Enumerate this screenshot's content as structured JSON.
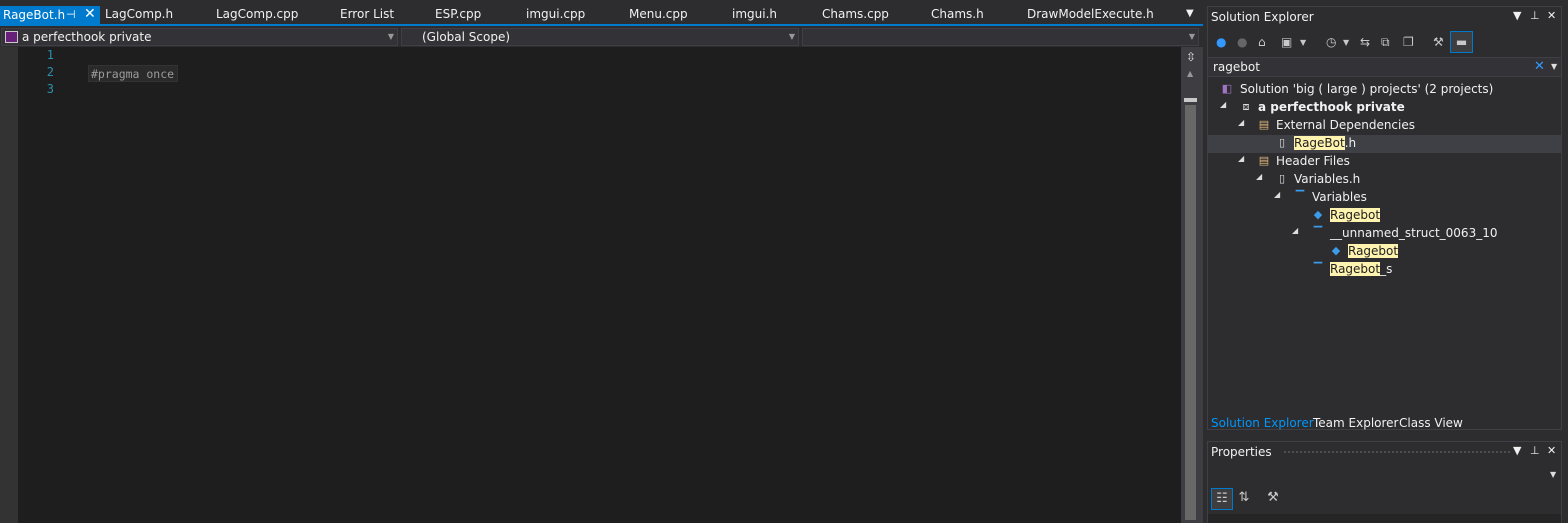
{
  "tabs": {
    "active": {
      "label": "RageBot.h",
      "pin": "⊣",
      "close": "✕"
    },
    "others": [
      "LagComp.h",
      "LagComp.cpp",
      "Error List",
      "ESP.cpp",
      "imgui.cpp",
      "Menu.cpp",
      "imgui.h",
      "Chams.cpp",
      "Chams.h",
      "DrawModelExecute.h"
    ]
  },
  "navbar": {
    "project": "a perfecthook private",
    "scope": "(Global Scope)",
    "member": ""
  },
  "editor": {
    "line_numbers": [
      "1",
      "2",
      "3"
    ],
    "code": "#pragma once"
  },
  "solution_explorer": {
    "title": "Solution Explorer",
    "search_value": "ragebot",
    "tree": [
      {
        "text": "Solution 'big ( large ) projects' (2 projects)",
        "icon": "solution-icon"
      },
      {
        "text": "a perfecthook private",
        "icon": "project-icon"
      },
      {
        "text": "External Dependencies",
        "icon": "folder-icon"
      },
      {
        "hl": "RageBot",
        "rest": ".h",
        "icon": "file-icon"
      },
      {
        "text": "Header Files",
        "icon": "folder-icon"
      },
      {
        "text": "Variables.h",
        "icon": "file-icon"
      },
      {
        "text": "Variables",
        "icon": "struct-icon"
      },
      {
        "hl": "Ragebot",
        "rest": "",
        "icon": "field-icon"
      },
      {
        "text": "__unnamed_struct_0063_10",
        "icon": "struct-icon"
      },
      {
        "hl": "Ragebot",
        "rest": "",
        "icon": "field-icon"
      },
      {
        "hl": "Ragebot",
        "rest": "_s",
        "icon": "struct-icon"
      }
    ],
    "bottom_tabs": [
      "Solution Explorer",
      "Team Explorer",
      "Class View"
    ]
  },
  "properties": {
    "title": "Properties"
  },
  "colors": {
    "accent": "#007acc",
    "editor_bg": "#1e1e1e",
    "chrome_bg": "#2d2d30",
    "highlight": "#fff3b0",
    "line_number": "#2b91af"
  }
}
